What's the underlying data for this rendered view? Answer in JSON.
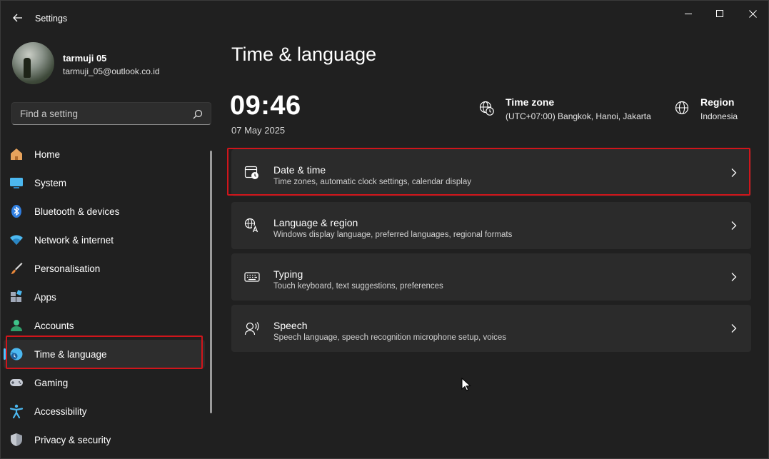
{
  "window": {
    "title": "Settings"
  },
  "profile": {
    "name": "tarmuji 05",
    "email": "tarmuji_05@outlook.co.id"
  },
  "search": {
    "placeholder": "Find a setting"
  },
  "sidebar": {
    "items": [
      {
        "label": "Home",
        "icon": "home-icon"
      },
      {
        "label": "System",
        "icon": "system-icon"
      },
      {
        "label": "Bluetooth & devices",
        "icon": "bluetooth-icon"
      },
      {
        "label": "Network & internet",
        "icon": "wifi-icon"
      },
      {
        "label": "Personalisation",
        "icon": "brush-icon"
      },
      {
        "label": "Apps",
        "icon": "apps-icon"
      },
      {
        "label": "Accounts",
        "icon": "accounts-icon"
      },
      {
        "label": "Time & language",
        "icon": "time-language-icon",
        "active": true
      },
      {
        "label": "Gaming",
        "icon": "gaming-icon"
      },
      {
        "label": "Accessibility",
        "icon": "accessibility-icon"
      },
      {
        "label": "Privacy & security",
        "icon": "shield-icon"
      }
    ]
  },
  "main": {
    "title": "Time & language",
    "time": "09:46",
    "date": "07 May 2025",
    "time_zone": {
      "title": "Time zone",
      "value": "(UTC+07:00) Bangkok, Hanoi, Jakarta"
    },
    "region": {
      "title": "Region",
      "value": "Indonesia"
    },
    "cards": [
      {
        "title": "Date & time",
        "description": "Time zones, automatic clock settings, calendar display",
        "icon": "calendar-clock-icon"
      },
      {
        "title": "Language & region",
        "description": "Windows display language, preferred languages, regional formats",
        "icon": "language-icon"
      },
      {
        "title": "Typing",
        "description": "Touch keyboard, text suggestions, preferences",
        "icon": "keyboard-icon"
      },
      {
        "title": "Speech",
        "description": "Speech language, speech recognition microphone setup, voices",
        "icon": "speech-icon"
      }
    ]
  },
  "colors": {
    "accent": "#4cc2ff",
    "highlight": "#d0151b",
    "background": "#202020",
    "card": "#2b2b2b"
  }
}
